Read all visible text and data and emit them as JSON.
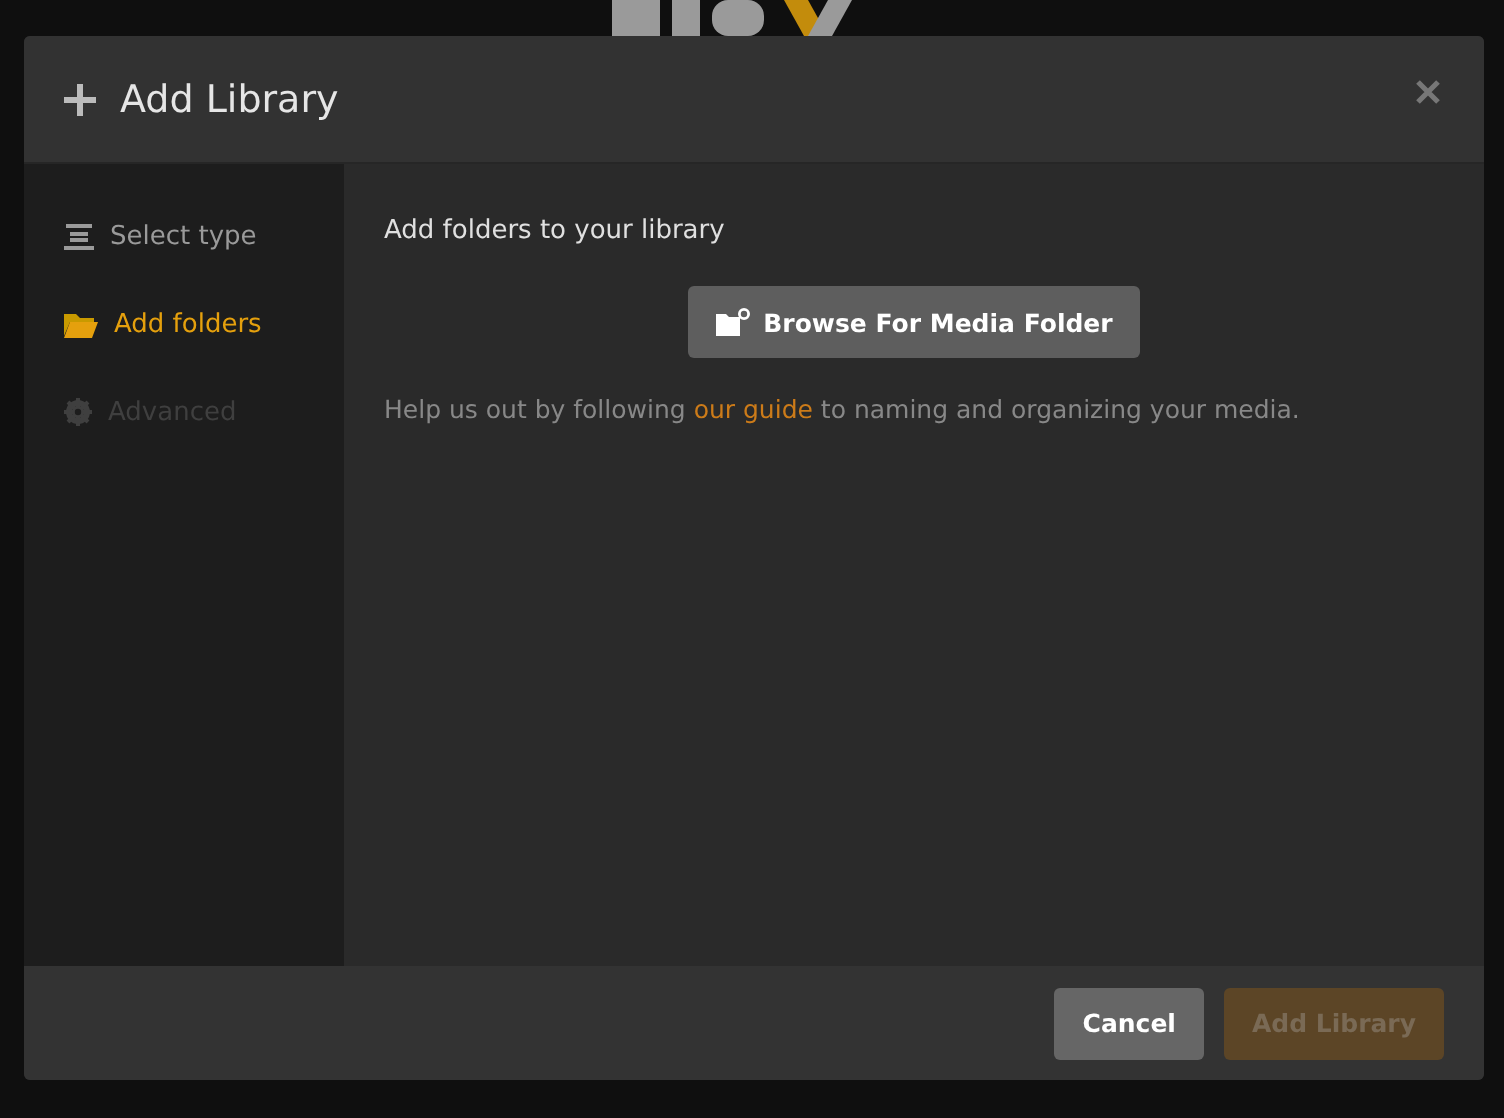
{
  "dialog": {
    "title": "Add Library"
  },
  "steps": [
    {
      "kind": "list",
      "label": "Select type",
      "selected": false,
      "disabled": false
    },
    {
      "kind": "folder",
      "label": "Add folders",
      "selected": true,
      "disabled": false
    },
    {
      "kind": "gear",
      "label": "Advanced",
      "selected": false,
      "disabled": true
    }
  ],
  "content": {
    "heading": "Add folders to your library",
    "browse_button": "Browse For Media Folder",
    "help": {
      "before": "Help us out by following ",
      "link": "our guide",
      "after": " to naming and organizing your media."
    }
  },
  "footer": {
    "cancel": "Cancel",
    "submit": {
      "label": "Add Library",
      "disabled": true
    }
  }
}
